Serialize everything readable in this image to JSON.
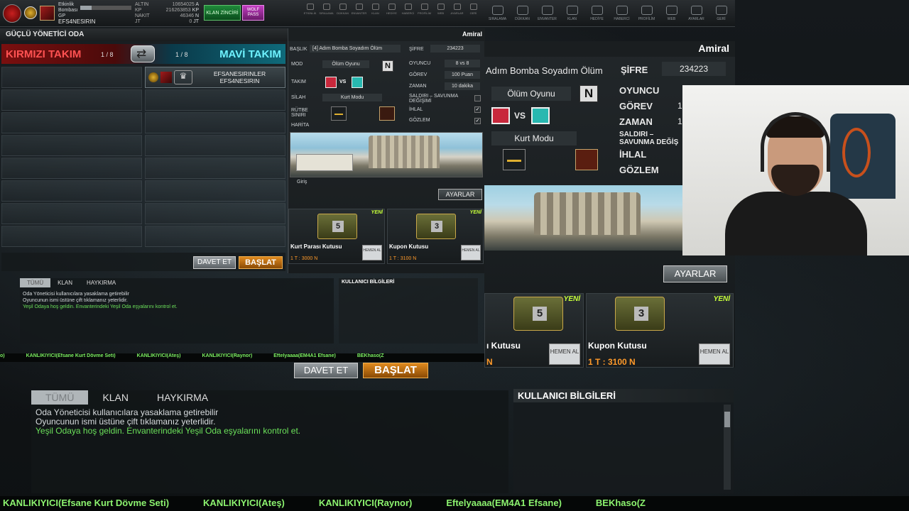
{
  "player": {
    "event_label": "Etkinlik Bombası",
    "currency_label": "GP",
    "name": "EFS4NESIRIN",
    "stats": [
      {
        "label": "ALTIN",
        "value": "10654025",
        "unit": "A"
      },
      {
        "label": "KP",
        "value": "216263853",
        "unit": "KP"
      },
      {
        "label": "NAKIT",
        "value": "46346",
        "unit": "N"
      },
      {
        "label": "JT",
        "value": "0",
        "unit": "JT"
      }
    ],
    "xp_progress": 0.22
  },
  "topbar": {
    "klan_btn": "KLAN ZİNCİRİ",
    "wolf_btn": "WOLF PASS",
    "small_menu": [
      "ETKİNLİK",
      "SIRALAMA",
      "DÜKKAN",
      "ENVANTER",
      "KLAN",
      "HEDİYE",
      "HABERCİ",
      "PROFİLİM",
      "WEB",
      "AYARLAR",
      "GERİ"
    ],
    "big_menu": [
      "SIRALAMA",
      "DÜKKAN",
      "ENVANTER",
      "KLAN",
      "HEDİYE",
      "HABERCİ",
      "PROFİLİM",
      "WEB",
      "AYARLAR",
      "GERİ"
    ]
  },
  "room": {
    "title": "GÜÇLÜ YÖNETİCİ ODA",
    "rank": "Amiral",
    "red_team": "KIRMIZI TAKIM",
    "blue_team": "MAVİ TAKIM",
    "red_count": "1 / 8",
    "blue_count": "1 / 8",
    "occupant_line1": "EFSANESIRINLER",
    "occupant_line2": "EFS4NESIRIN",
    "davet": "DAVET ET",
    "baslat": "BAŞLAT"
  },
  "settings": {
    "baslik_label": "BAŞLIK",
    "baslik_value": "[4] Adım Bomba Soyadım Ölüm",
    "sifre_label": "ŞİFRE",
    "sifre_value": "234223",
    "mod_label": "MOD",
    "mod_value": "Ölüm Oyunu",
    "n_badge": "N",
    "oyuncu_label": "OYUNCU",
    "oyuncu_value": "8 vs 8",
    "gorev_label": "GÖREV",
    "gorev_value": "100 Puan",
    "zaman_label": "ZAMAN",
    "zaman_value": "10 dakika",
    "takim_label": "TAKIM",
    "vs": "VS",
    "silah_label": "SİLAH",
    "silah_value": "Kurt Modu",
    "saldiri_label": "SALDIRI – SAVUNMA DEĞİŞİMİ",
    "rutbe_label": "RÜTBE SINIRI",
    "ihlal_label": "İHLAL",
    "gozlem_label": "GÖZLEM",
    "harita_label": "HARİTA",
    "map_name": "Giriş",
    "ayarlar": "AYARLAR"
  },
  "items": [
    {
      "badge": "YENİ",
      "number": "5",
      "title": "Kurt Parası Kutusu",
      "price": "1 T : 3000 N",
      "buy": "HEMEN AL"
    },
    {
      "badge": "YENİ",
      "number": "3",
      "title": "Kupon Kutusu",
      "price": "1 T : 3100 N",
      "buy": "HEMEN AL"
    }
  ],
  "chat": {
    "tabs": [
      "TÜMÜ",
      "KLAN",
      "HAYKIRMA"
    ],
    "lines": [
      "Oda Yöneticisi kullanıcılara yasaklama getirebilir",
      "Oyuncunun ismi üstüne çift tıklamanız yeterlidir."
    ],
    "welcome": "Yeşil Odaya hoş geldin. Envanterindeki Yeşil Oda eşyalarını kontrol et.",
    "user_info": "KULLANICI BİLGİLERİ"
  },
  "ticker_small": [
    "o)",
    "KANLIKIYICI(Efsane Kurt Dövme Seti)",
    "KANLIKIYICI(Ateş)",
    "KANLIKIYICI(Raynor)",
    "Eftelyaaaa(EM4A1 Efsane)",
    "BEKhaso(Z"
  ],
  "ticker": [
    "KANLIKIYICI(Efsane Kurt Dövme Seti)",
    "KANLIKIYICI(Ateş)",
    "KANLIKIYICI(Raynor)",
    "Eftelyaaaa(EM4A1 Efsane)",
    "BEKhaso(Z"
  ],
  "zoom": {
    "baslik_value": "Adım Bomba Soyadım Ölüm",
    "sifre_label": "ŞİFRE",
    "sifre_value": "234223",
    "amiral": "Amiral",
    "mod_value": "Ölüm Oyunu",
    "n_badge": "N",
    "oyuncu_label": "OYUNCU",
    "gorev_label": "GÖREV",
    "zaman_label": "ZAMAN",
    "vs": "VS",
    "silah_value": "Kurt Modu",
    "saldiri_label": "SALDIRI – SAVUNMA DEĞİŞ",
    "ihlal_label": "İHLAL",
    "gozlem_label": "GÖZLEM",
    "ayarlar": "AYARLAR",
    "item1_title": "ı Kutusu",
    "item1_price": "N",
    "item2_title": "Kupon Kutusu",
    "item2_price": "1 T : 3100 N",
    "yeni": "YENİ",
    "hemen": "HEMEN AL",
    "gorev_partial": "1",
    "zaman_partial": "1"
  },
  "zoom_lower": {
    "davet": "DAVET ET",
    "baslat": "BAŞLAT",
    "tabs": [
      "TÜMÜ",
      "KLAN",
      "HAYKIRMA"
    ],
    "line1": "Oda Yöneticisi kullanıcılara yasaklama getirebilir",
    "line2": "Oyuncunun ismi üstüne çift tıklamanız yeterlidir.",
    "welcome": "Yeşil Odaya hoş geldin. Envanterindeki Yeşil Oda eşyalarını kontrol et.",
    "user_info": "KULLANICI BİLGİLERİ"
  }
}
